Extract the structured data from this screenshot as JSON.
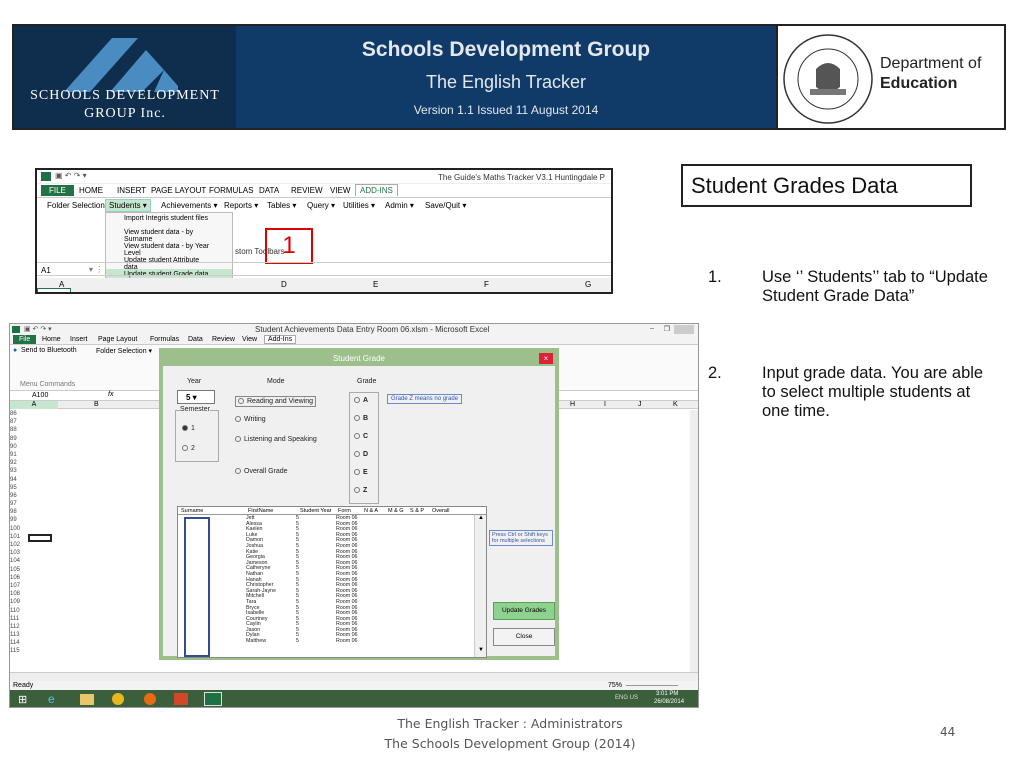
{
  "banner": {
    "org_line1": "SCHOOLS DEVELOPMENT",
    "org_line2": "GROUP Inc.",
    "title": "Schools Development Group",
    "subtitle": "The English Tracker",
    "version": "Version 1.1 Issued 11 August 2014",
    "dept_line1": "Department of",
    "dept_line2": "Education"
  },
  "excel_top": {
    "window_title": "The Guide's Maths Tracker V3.1 Huntingdale P",
    "tabs": [
      "FILE",
      "HOME",
      "INSERT",
      "PAGE LAYOUT",
      "FORMULAS",
      "DATA",
      "REVIEW",
      "VIEW",
      "ADD-INS"
    ],
    "menus": [
      "Folder Selection ▾",
      "Students ▾",
      "Achievements ▾",
      "Reports ▾",
      "Tables ▾",
      "Query ▾",
      "Utilities ▾",
      "Admin ▾",
      "Save/Quit ▾"
    ],
    "dropdown": [
      "Import Integris student files",
      "View student data - by Surname",
      "View student data - by Year Level",
      "Update student Attribute data",
      "Update student Grade data"
    ],
    "toolbar_text": "stom Toolbars",
    "callout": "1",
    "cell_ref": "A1",
    "col_headers": [
      "A",
      "D",
      "E",
      "F",
      "G"
    ]
  },
  "excel_main": {
    "window_title": "Student Achievements Data Entry Room 06.xlsm - Microsoft Excel",
    "tabs": [
      "File",
      "Home",
      "Insert",
      "Page Layout",
      "Formulas",
      "Data",
      "Review",
      "View",
      "Add-Ins"
    ],
    "bluetooth": "Send to Bluetooth",
    "folder": "Folder Selection ▾",
    "menu_commands": "Menu Commands",
    "cell_ref": "A100",
    "fx": "fx",
    "col_headers": [
      "A",
      "B",
      "H",
      "I",
      "J",
      "K"
    ],
    "row_numbers": [
      "86",
      "87",
      "88",
      "89",
      "90",
      "91",
      "92",
      "93",
      "94",
      "95",
      "96",
      "97",
      "98",
      "99",
      "100",
      "101",
      "102",
      "103",
      "104",
      "105",
      "106",
      "107",
      "108",
      "109",
      "110",
      "111",
      "112",
      "113",
      "114",
      "115"
    ],
    "status": "Ready",
    "zoom": "75%",
    "tray": "ENG US",
    "time": "3:01 PM",
    "date": "26/08/2014"
  },
  "dialog": {
    "title": "Student Grade",
    "year_label": "Year",
    "year_value": "5",
    "mode_label": "Mode",
    "grade_label": "Grade",
    "semester_label": "Semester",
    "semesters": [
      "1",
      "2"
    ],
    "modes": [
      "Reading and Viewing",
      "Writing",
      "Listening and Speaking",
      "Overall Grade"
    ],
    "grades": [
      "A",
      "B",
      "C",
      "D",
      "E",
      "Z"
    ],
    "grade_note": "Grade Z means no grade",
    "ctrl_note": "Press Ctrl or Shift keys for multiple selections",
    "update_button": "Update Grades",
    "close_button": "Close",
    "list_headers": [
      "Surname",
      "FirstName",
      "Student Year",
      "Form",
      "N & A",
      "M & G",
      "S & P",
      "Overall"
    ],
    "students": [
      "Jett",
      "Alessa",
      "Kaelen",
      "Luke",
      "Damon",
      "Joshua",
      "Katie",
      "Georgia",
      "Jameson",
      "Catheryne",
      "Nathan",
      "Hanah",
      "Christopher",
      "Sarah-Jayne",
      "Mitchell",
      "Tara",
      "Bryce",
      "Isabelle",
      "Courtney",
      "Caylin",
      "Jason",
      "Dylan",
      "Matthew"
    ],
    "student_year": "5",
    "student_form": "Room 06"
  },
  "slide": {
    "heading": "Student Grades Data",
    "item1_num": "1.",
    "item1": "Use ‘’ Students’’ tab to “Update Student Grade Data”",
    "item2_num": "2.",
    "item2": "Input grade data.  You are able to select multiple students at one time.",
    "footer_line1": "The English Tracker :   Administrators",
    "footer_line2": "The Schools Development Group  (2014)",
    "page_number": "44"
  }
}
